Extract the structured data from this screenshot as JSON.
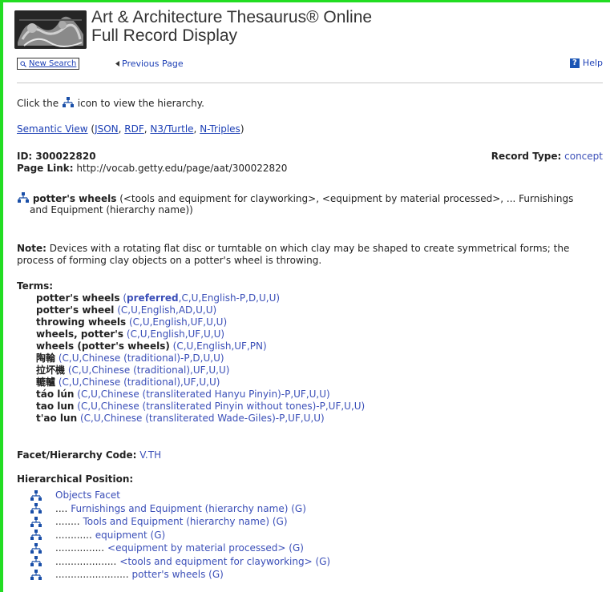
{
  "header": {
    "title_line1": "Art & Architecture Thesaurus® Online",
    "title_line2": "Full Record Display"
  },
  "nav": {
    "new_search": "New Search",
    "previous_page": "Previous Page",
    "help": "Help"
  },
  "intro": {
    "before": "Click the",
    "after": "icon to view the hierarchy."
  },
  "semantic": {
    "semantic_view": "Semantic View",
    "json": "JSON",
    "rdf": "RDF",
    "n3": "N3/Turtle",
    "ntriples": "N-Triples"
  },
  "record": {
    "id_label": "ID:",
    "id": "300022820",
    "page_link_label": "Page Link:",
    "page_link": "http://vocab.getty.edu/page/aat/300022820",
    "record_type_label": "Record Type:",
    "record_type": "concept"
  },
  "main_term": {
    "name": "potter's wheels",
    "context_line1": "(<tools and equipment for clayworking>, <equipment by material processed>, ... Furnishings",
    "context_line2": "and Equipment (hierarchy name))"
  },
  "note": {
    "label": "Note:",
    "line1": "Devices with a rotating flat disc or turntable on which clay may be shaped to create symmetrical forms; the",
    "line2": "process of forming clay objects on a potter's wheel is throwing."
  },
  "terms": {
    "label": "Terms:",
    "items": [
      {
        "term": "potter's wheels",
        "preferred": "preferred",
        "attrs": ",C,U,English-P,D,U,U)"
      },
      {
        "term": "potter's wheel",
        "attrs": "(C,U,English,AD,U,U)"
      },
      {
        "term": "throwing wheels",
        "attrs": "(C,U,English,UF,U,U)"
      },
      {
        "term": "wheels, potter's",
        "attrs": "(C,U,English,UF,U,U)"
      },
      {
        "term": "wheels (potter's wheels)",
        "attrs": "(C,U,English,UF,PN)"
      },
      {
        "term": "陶輪",
        "attrs": "(C,U,Chinese (traditional)-P,D,U,U)"
      },
      {
        "term": "拉坏機",
        "attrs": "(C,U,Chinese (traditional),UF,U,U)"
      },
      {
        "term": "轆轤",
        "attrs": "(C,U,Chinese (traditional),UF,U,U)"
      },
      {
        "term": "táo lún",
        "attrs": "(C,U,Chinese (transliterated Hanyu Pinyin)-P,UF,U,U)"
      },
      {
        "term": "tao lun",
        "attrs": "(C,U,Chinese (transliterated Pinyin without tones)-P,UF,U,U)"
      },
      {
        "term": "t'ao lun",
        "attrs": "(C,U,Chinese (transliterated Wade-Giles)-P,UF,U,U)"
      }
    ]
  },
  "facet": {
    "label": "Facet/Hierarchy Code:",
    "code": "V.TH"
  },
  "hierarchy": {
    "label": "Hierarchical Position:",
    "items": [
      {
        "dots": "",
        "name": "Objects Facet"
      },
      {
        "dots": "....",
        "name": "Furnishings and Equipment (hierarchy name) (G)"
      },
      {
        "dots": "........",
        "name": "Tools and Equipment (hierarchy name) (G)"
      },
      {
        "dots": "............",
        "name": "equipment (G)"
      },
      {
        "dots": "................",
        "name": "<equipment by material processed> (G)"
      },
      {
        "dots": "....................",
        "name": "<tools and equipment for clayworking> (G)"
      },
      {
        "dots": "........................",
        "name": "potter's wheels (G)"
      }
    ]
  },
  "colors": {
    "frame_green": "#22dd22",
    "link_blue": "#1c3fb5",
    "icon_blue": "#1a4fa8"
  }
}
